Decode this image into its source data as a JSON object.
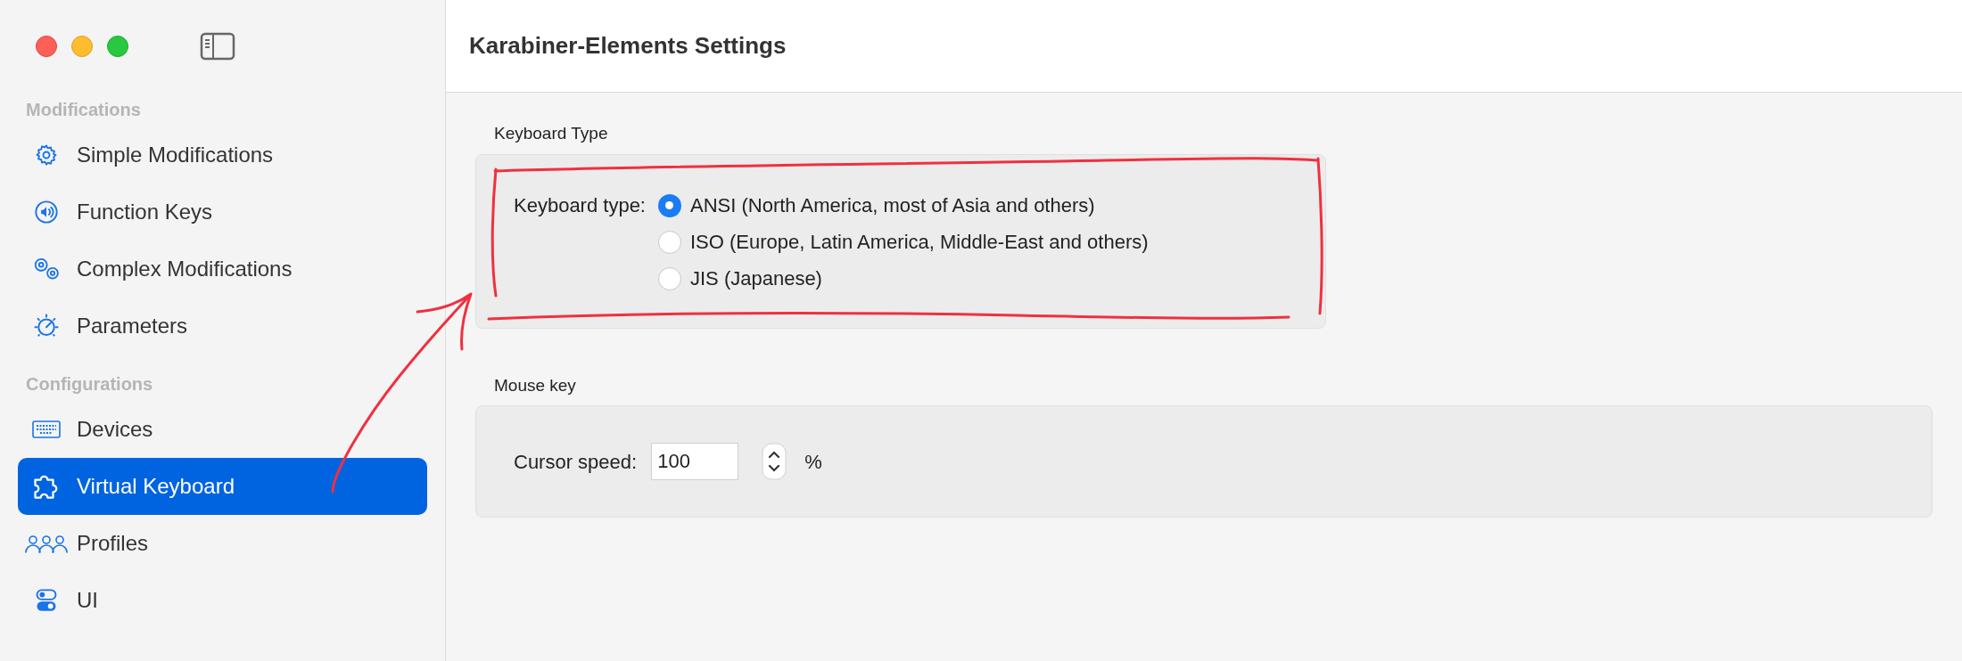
{
  "window": {
    "title": "Karabiner-Elements Settings"
  },
  "sidebar": {
    "sections": [
      {
        "title": "Modifications",
        "items": [
          {
            "label": "Simple Modifications",
            "kind": "gear",
            "selected": false
          },
          {
            "label": "Function Keys",
            "kind": "speaker",
            "selected": false
          },
          {
            "label": "Complex Modifications",
            "kind": "gears",
            "selected": false
          },
          {
            "label": "Parameters",
            "kind": "gauge",
            "selected": false
          }
        ]
      },
      {
        "title": "Configurations",
        "items": [
          {
            "label": "Devices",
            "kind": "keyboard",
            "selected": false
          },
          {
            "label": "Virtual Keyboard",
            "kind": "puzzle",
            "selected": true
          },
          {
            "label": "Profiles",
            "kind": "people",
            "selected": false
          },
          {
            "label": "UI",
            "kind": "toggles",
            "selected": false
          }
        ]
      }
    ]
  },
  "keyboard_type": {
    "heading": "Keyboard Type",
    "label": "Keyboard type:",
    "options": [
      {
        "label": "ANSI (North America, most of Asia and others)",
        "selected": true
      },
      {
        "label": "ISO (Europe, Latin America, Middle-East and others)",
        "selected": false
      },
      {
        "label": "JIS (Japanese)",
        "selected": false
      }
    ]
  },
  "mouse_key": {
    "heading": "Mouse key",
    "label": "Cursor speed:",
    "value": "100",
    "unit": "%"
  },
  "annotations": {
    "outline": true,
    "arrow": true
  }
}
